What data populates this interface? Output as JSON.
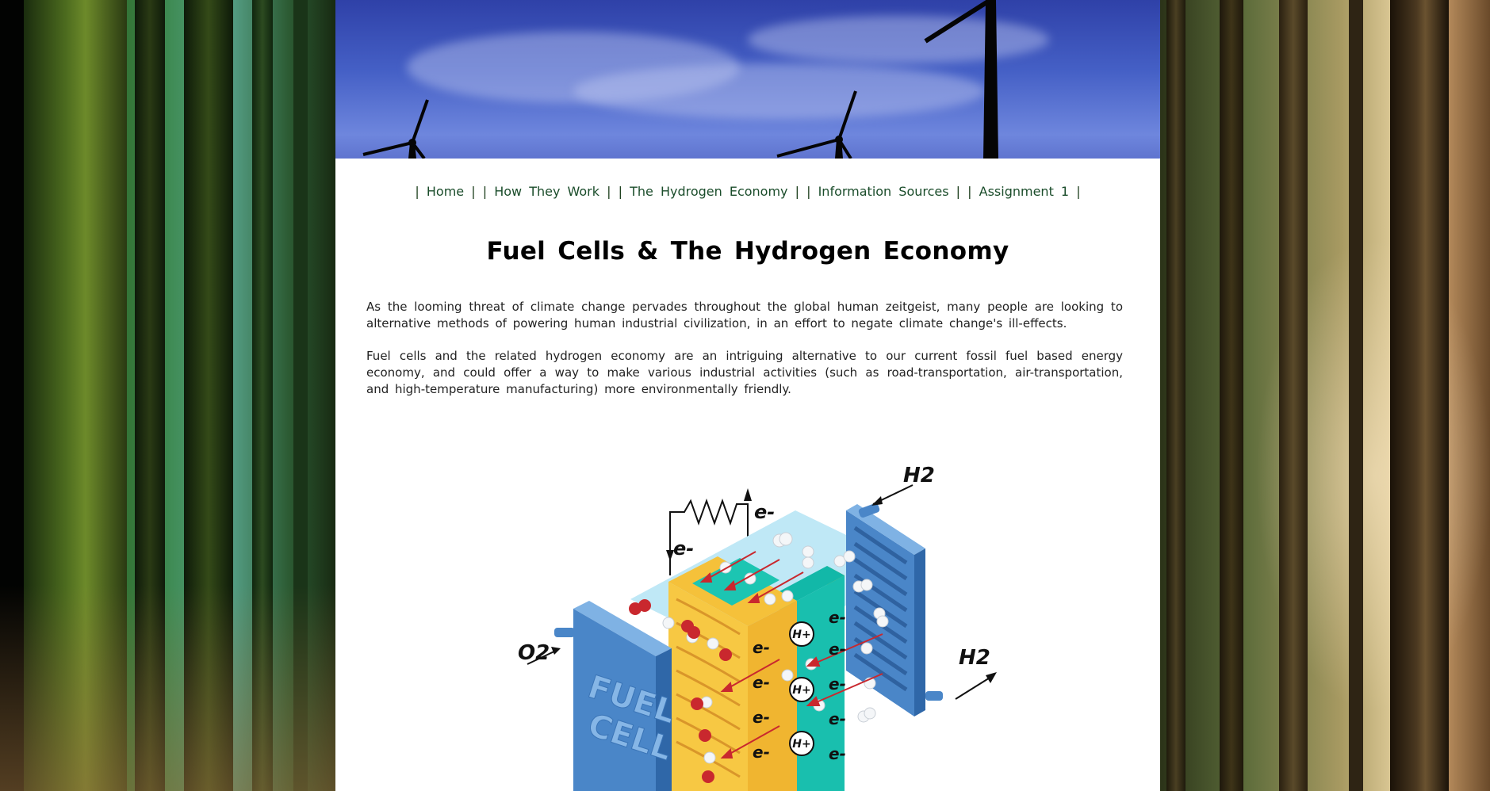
{
  "nav": {
    "items": [
      {
        "label": "Home"
      },
      {
        "label": "How They Work"
      },
      {
        "label": "The Hydrogen Economy"
      },
      {
        "label": "Information Sources"
      },
      {
        "label": "Assignment 1"
      }
    ],
    "separator": "|"
  },
  "main": {
    "title": "Fuel Cells & The Hydrogen Economy",
    "paragraphs": [
      "As the looming threat of climate change pervades throughout the global human zeitgeist, many people are looking to alternative methods of powering human industrial civilization, in an effort to negate climate change's ill-effects.",
      "Fuel cells and the related hydrogen economy are an intriguing alternative to our current fossil fuel based energy economy, and could offer a way to make various industrial activities (such as road-transportation, air-transportation, and high-temperature manufacturing) more environmentally friendly."
    ]
  },
  "figure": {
    "h2_top": "H2",
    "h2_right": "H2",
    "o2": "O2",
    "electron": "e-",
    "proton": "H+",
    "cell_line1": "FUEL",
    "cell_line2": "CELL"
  },
  "colors": {
    "nav_link": "#1b4d2b",
    "banner_sky": "#4560c6",
    "anode_plate": "#4a86c8",
    "electrolyte": "#1fc9b4",
    "catalyst": "#f5c13a"
  }
}
